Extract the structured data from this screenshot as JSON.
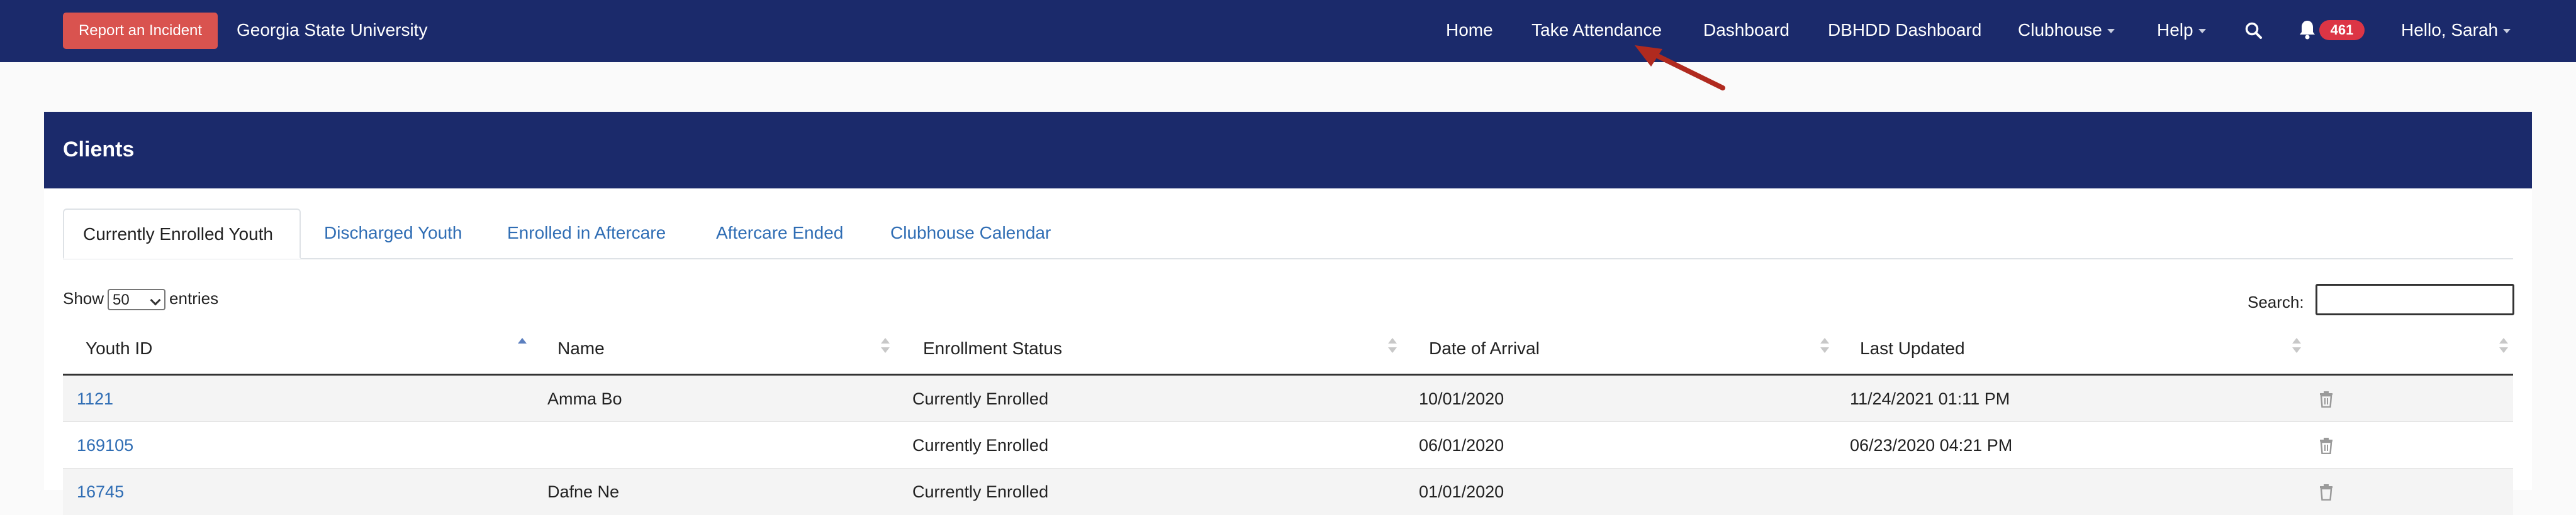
{
  "navbar": {
    "report_button": "Report an Incident",
    "brand": "Georgia State University",
    "items": {
      "home": "Home",
      "take_attendance": "Take Attendance",
      "dashboard": "Dashboard",
      "dbhdd_dashboard": "DBHDD Dashboard",
      "clubhouse": "Clubhouse",
      "help": "Help"
    },
    "search_icon": "search-icon",
    "notification_icon": "bell-icon",
    "notification_count": "461",
    "user_greeting": "Hello, Sarah"
  },
  "annotation": {
    "arrow_color": "#b02a1f"
  },
  "panel": {
    "title": "Clients"
  },
  "tabs": {
    "currently_enrolled": "Currently Enrolled Youth",
    "discharged": "Discharged Youth",
    "enrolled_aftercare": "Enrolled in Aftercare",
    "aftercare_ended": "Aftercare Ended",
    "clubhouse_calendar": "Clubhouse Calendar"
  },
  "controls": {
    "show_label": "Show",
    "page_size": "50",
    "entries_label": "entries",
    "search_label": "Search:",
    "search_value": ""
  },
  "table": {
    "headers": {
      "youth_id": "Youth ID",
      "name": "Name",
      "enrollment_status": "Enrollment Status",
      "date_of_arrival": "Date of Arrival",
      "last_updated": "Last Updated"
    },
    "rows": [
      {
        "youth_id": "1121",
        "name": "Amma Bo",
        "status": "Currently Enrolled",
        "arrival": "10/01/2020",
        "updated": "11/24/2021 01:11 PM"
      },
      {
        "youth_id": "169105",
        "name": "",
        "status": "Currently Enrolled",
        "arrival": "06/01/2020",
        "updated": "06/23/2020 04:21 PM"
      },
      {
        "youth_id": "16745",
        "name": "Dafne Ne",
        "status": "Currently Enrolled",
        "arrival": "01/01/2020",
        "updated": ""
      }
    ]
  },
  "colors": {
    "navbar": "#1b2a6b",
    "report_button": "#d9534f",
    "badge": "#dc3545",
    "link": "#2f6db4"
  }
}
